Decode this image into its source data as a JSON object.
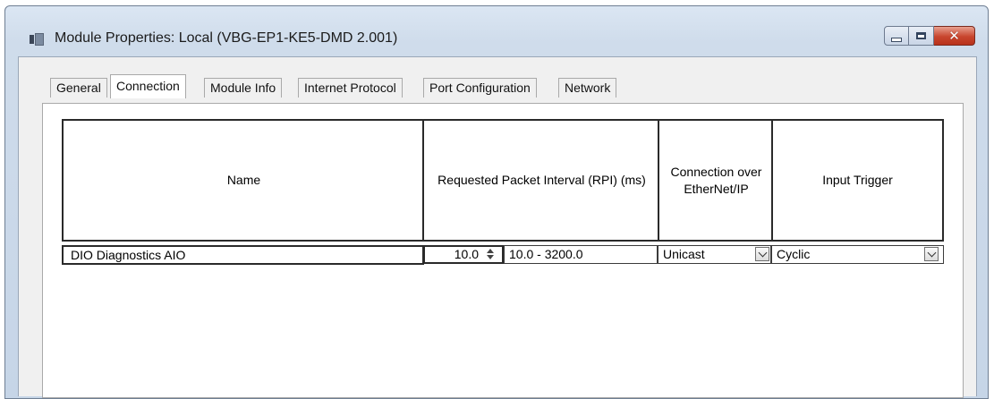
{
  "window": {
    "title": "Module Properties: Local (VBG-EP1-KE5-DMD 2.001)",
    "caption_buttons": [
      "minimize",
      "maximize",
      "close"
    ]
  },
  "tabs": [
    {
      "label": "General",
      "active": false
    },
    {
      "label": "Connection",
      "active": true
    },
    {
      "label": "Module Info",
      "active": false
    },
    {
      "label": "Internet Protocol",
      "active": false
    },
    {
      "label": "Port Configuration",
      "active": false
    },
    {
      "label": "Network",
      "active": false
    }
  ],
  "grid": {
    "columns": [
      {
        "header": "Name"
      },
      {
        "header": "Requested Packet Interval (RPI) (ms)"
      },
      {
        "header": "Connection over EtherNet/IP"
      },
      {
        "header": "Input Trigger"
      }
    ],
    "rows": [
      {
        "name": "DIO Diagnostics AIO",
        "rpi_value": "10.0",
        "rpi_range": "10.0 - 3200.0",
        "connection": "Unicast",
        "input_trigger": "Cyclic"
      }
    ]
  },
  "icons": {
    "window": "module-properties-icon",
    "spinner": "spinner-arrows-icon",
    "dropdown": "chevron-down-icon"
  }
}
